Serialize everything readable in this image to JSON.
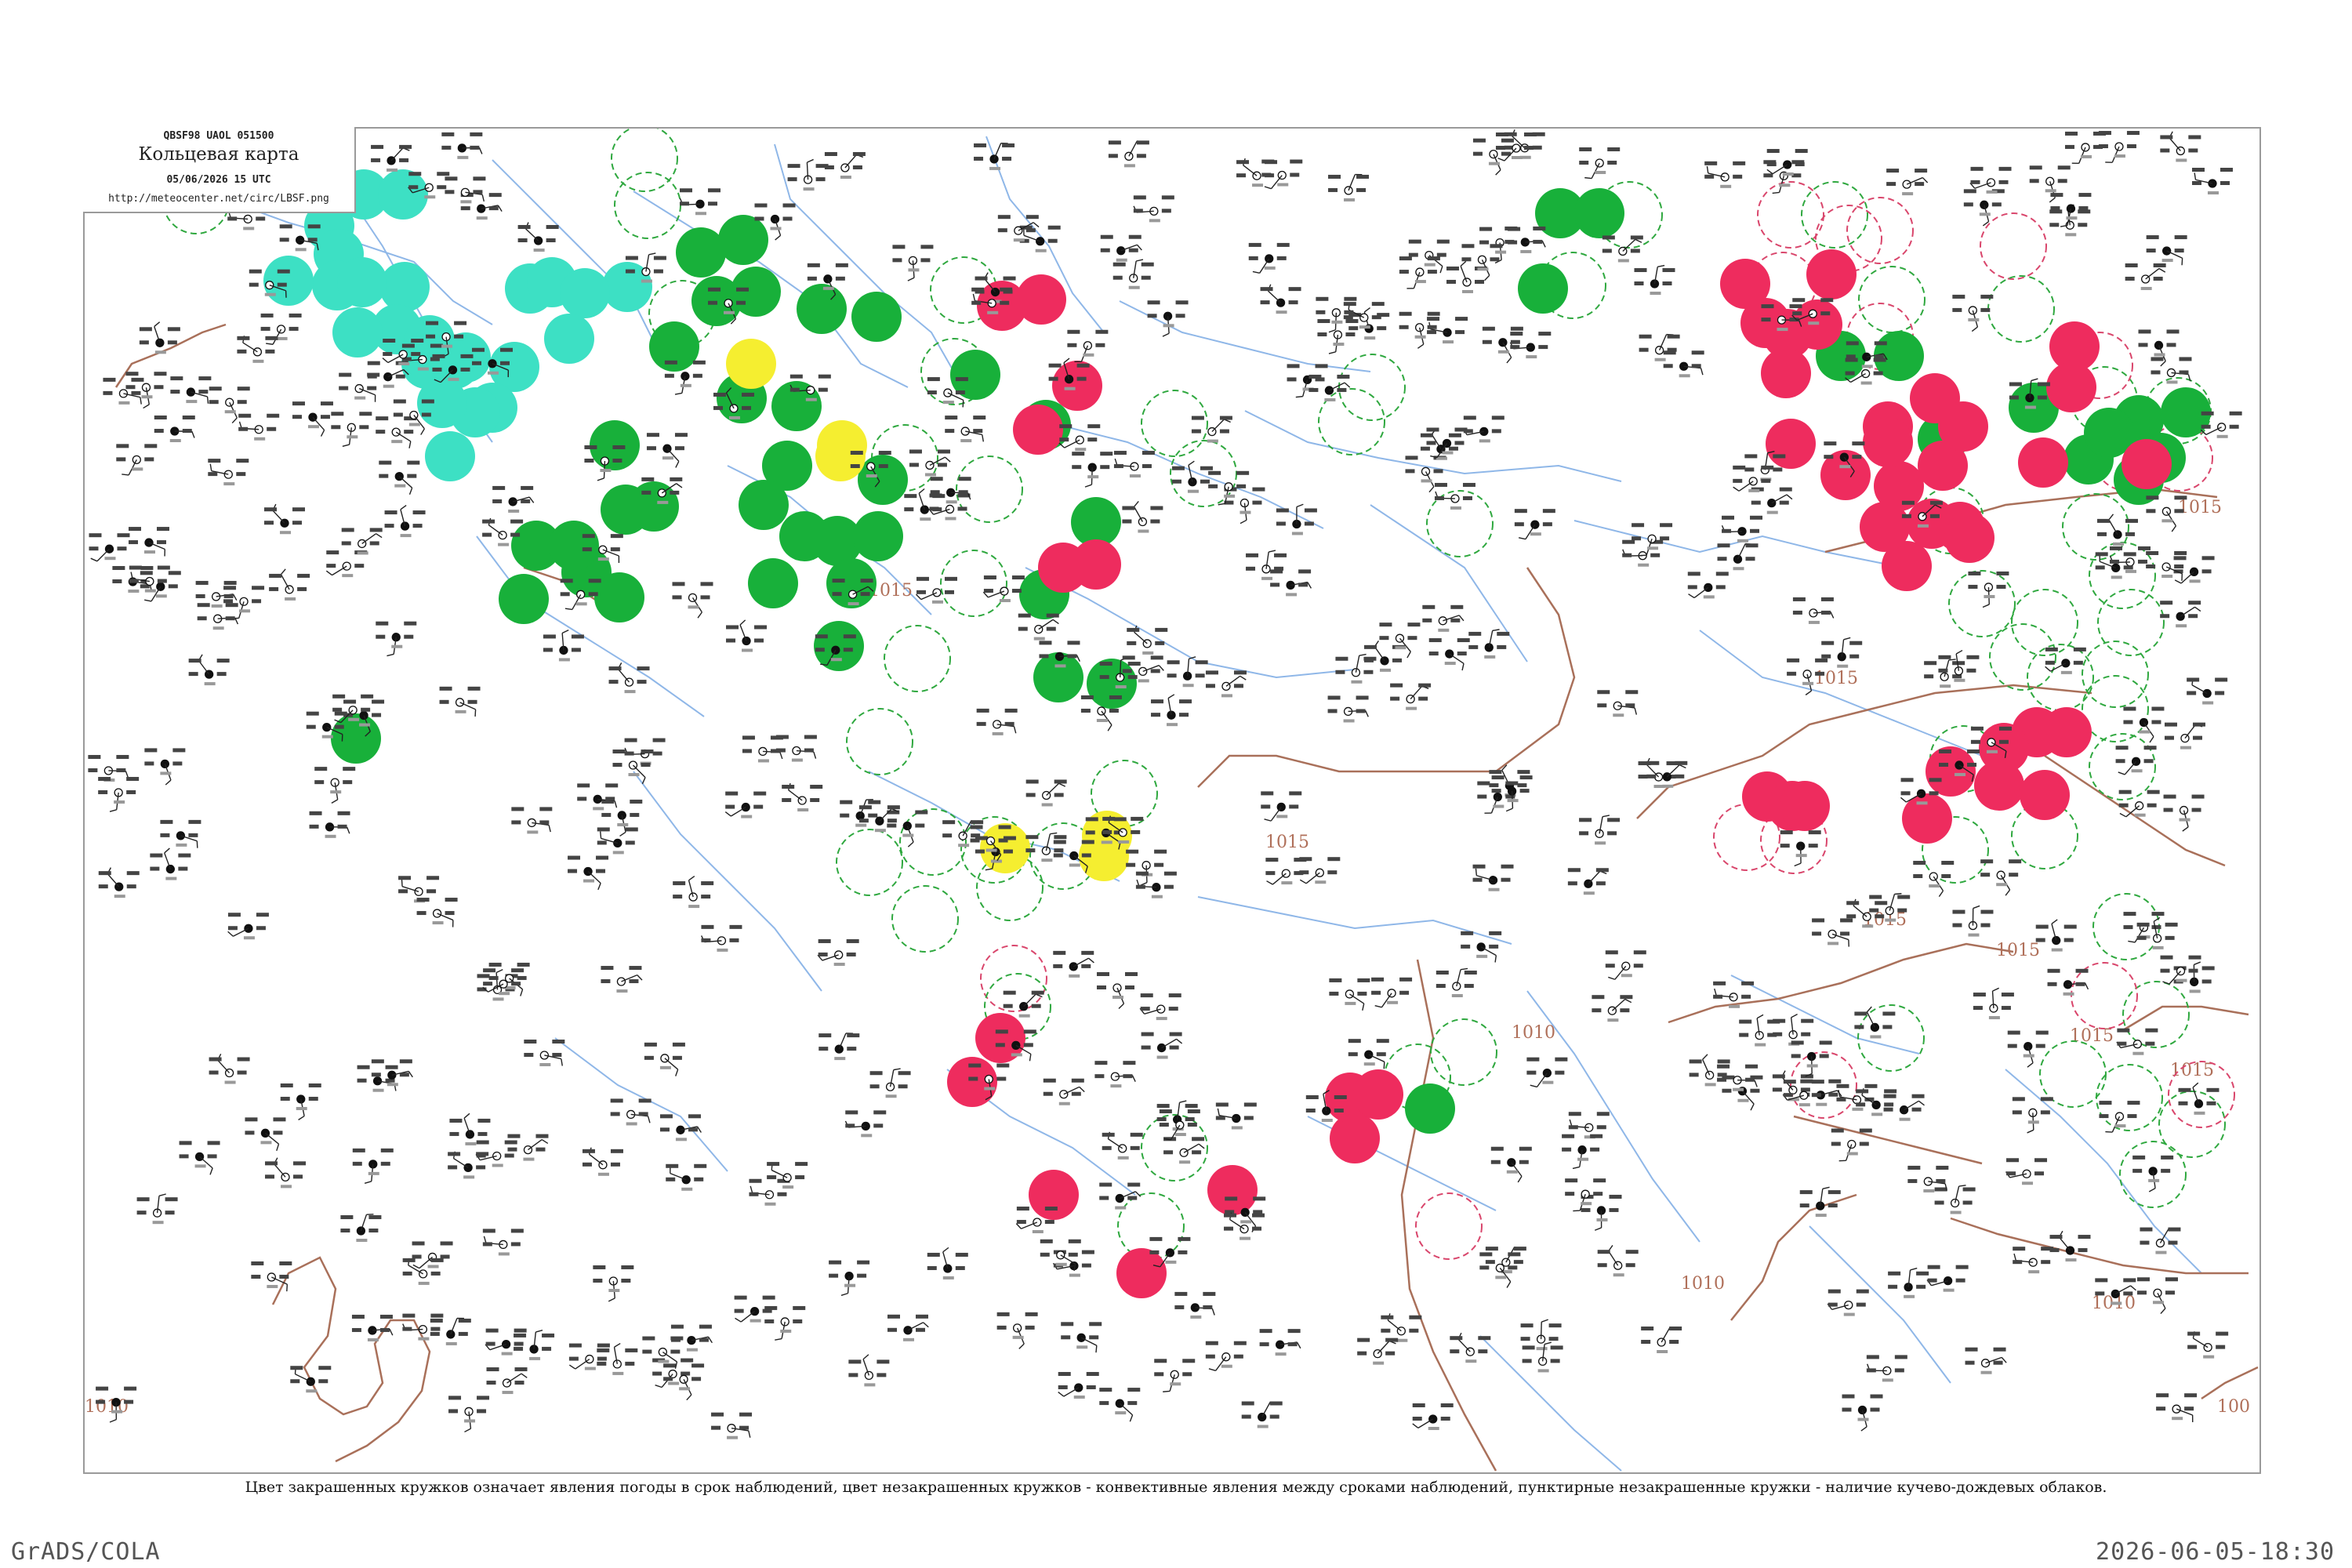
{
  "header": {
    "code_line": "QBSF98  UAOL  051500",
    "map_title": "Кольцевая карта",
    "datetime": "05/06/2026 15 UTC",
    "url": "http://meteocenter.net/circ/LBSF.png"
  },
  "isobars": [
    {
      "label": "1015"
    },
    {
      "label": "1015"
    },
    {
      "label": "1015"
    },
    {
      "label": "1015"
    },
    {
      "label": "1015"
    },
    {
      "label": "1015"
    },
    {
      "label": "1015"
    },
    {
      "label": "1015"
    },
    {
      "label": "1010"
    },
    {
      "label": "1010"
    },
    {
      "label": "1010"
    },
    {
      "label": "1010"
    },
    {
      "label": "100"
    }
  ],
  "legend_caption": "Цвет закрашенных кружков означает явления погоды в срок наблюдений, цвет незакрашенных кружков - конвективные явления между сроками наблюдений, пунктирные незакрашенные кружки - наличие кучево-дождевых облаков.",
  "footer": {
    "software": "GrADS/COLA",
    "generated": "2026-06-05-18:30"
  },
  "colors": {
    "green_fill": "#18b03a",
    "red_fill": "#ee2c5e",
    "cyan_fill": "#3de0c4",
    "yellow_fill": "#f5ee30",
    "green_ring": "#2fa83f",
    "red_ring": "#d9466c",
    "river": "#8fb7e8",
    "isobar": "#a9705a",
    "border": "#9a9a9a"
  }
}
